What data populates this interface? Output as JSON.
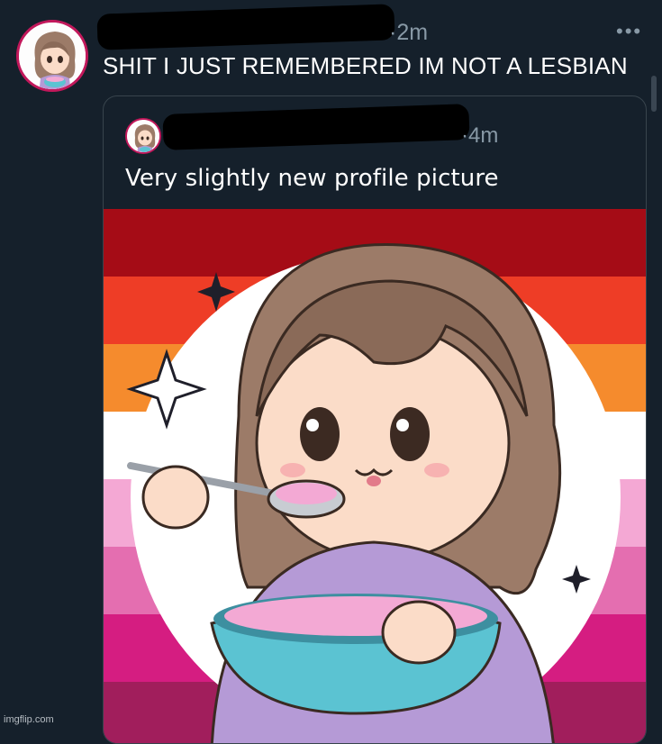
{
  "post": {
    "time": "·2m",
    "text": "SHIT I JUST REMEMBERED IM NOT A LESBIAN",
    "more": "•••"
  },
  "quoted": {
    "time": "·4m",
    "text": "Very slightly new profile picture"
  },
  "flag_colors": [
    "#a50c16",
    "#ee3d26",
    "#f58b2d",
    "#ffffff",
    "#f4a8d4",
    "#e46eb0",
    "#d51d81",
    "#a11e5c"
  ],
  "watermark": "imgflip.com"
}
